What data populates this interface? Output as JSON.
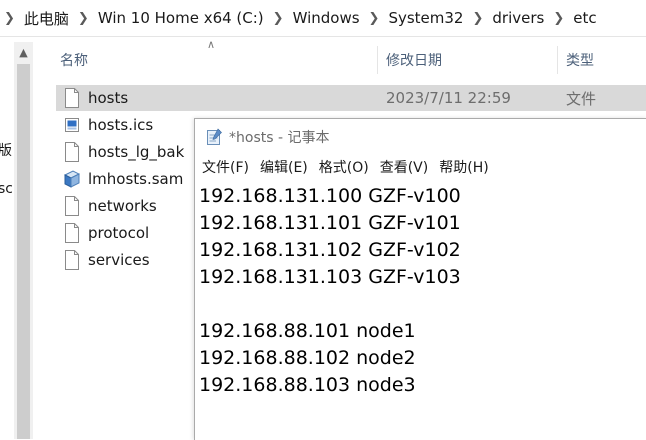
{
  "breadcrumb": [
    "此电脑",
    "Win 10 Home x64 (C:)",
    "Windows",
    "System32",
    "drivers",
    "etc"
  ],
  "left_fragments": [
    "版",
    "sc"
  ],
  "columns": {
    "name": "名称",
    "date": "修改日期",
    "type": "类型"
  },
  "files": [
    {
      "name": "hosts",
      "date": "2023/7/11 22:59",
      "type": "文件",
      "icon": "file-icon",
      "selected": true
    },
    {
      "name": "hosts.ics",
      "icon": "ics-file-icon"
    },
    {
      "name": "hosts_lg_bak",
      "icon": "file-icon"
    },
    {
      "name": "lmhosts.sam",
      "icon": "sam-file-icon"
    },
    {
      "name": "networks",
      "icon": "file-icon"
    },
    {
      "name": "protocol",
      "icon": "file-icon"
    },
    {
      "name": "services",
      "icon": "file-icon"
    }
  ],
  "notepad": {
    "title": "*hosts - 记事本",
    "menu": [
      "文件(F)",
      "编辑(E)",
      "格式(O)",
      "查看(V)",
      "帮助(H)"
    ],
    "lines": [
      "192.168.131.100 GZF-v100",
      "192.168.131.101 GZF-v101",
      "192.168.131.102 GZF-v102",
      "192.168.131.103 GZF-v103",
      "",
      "192.168.88.101 node1",
      "192.168.88.102 node2",
      "192.168.88.103 node3"
    ]
  },
  "colors": {
    "selection": "#d9d9d9",
    "header_text": "#4c607a",
    "secondary_text": "#6d6d6d"
  }
}
